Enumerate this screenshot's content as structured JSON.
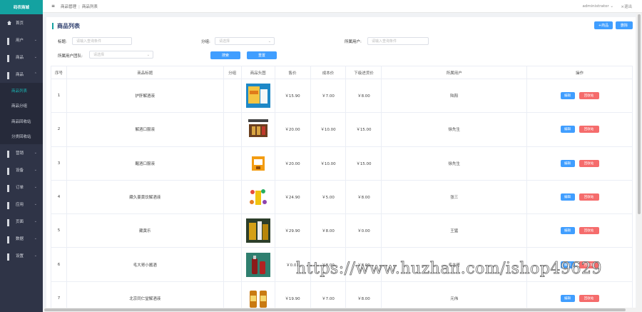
{
  "brand": "码农商城",
  "sidebar": {
    "items": [
      {
        "label": "首页",
        "icon": "home-icon",
        "chevron": false
      },
      {
        "label": "用户",
        "icon": "grid-icon",
        "chevron": true
      },
      {
        "label": "商品",
        "icon": "grid-icon",
        "chevron": true
      },
      {
        "label": "商品",
        "icon": "grid-icon",
        "chevron": true
      }
    ],
    "goods_submenu": [
      "商品列表",
      "商品分组",
      "商品回收站",
      "分类回收站"
    ],
    "items_after": [
      {
        "label": "营销",
        "icon": "grid-icon"
      },
      {
        "label": "设备",
        "icon": "grid-icon"
      },
      {
        "label": "订单",
        "icon": "grid-icon"
      },
      {
        "label": "应用",
        "icon": "grid-icon"
      },
      {
        "label": "页面",
        "icon": "grid-icon"
      },
      {
        "label": "数据",
        "icon": "grid-icon"
      },
      {
        "label": "设置",
        "icon": "grid-icon"
      }
    ]
  },
  "topbar": {
    "breadcrumb": [
      "商品管理",
      "商品列表"
    ],
    "user": "administrator",
    "logout": "退出"
  },
  "page": {
    "title": "商品列表",
    "add_button": "+商品",
    "delete_button": "删除"
  },
  "filters": {
    "title_label": "标题:",
    "title_placeholder": "请输入查询条件",
    "group_label": "分组:",
    "group_placeholder": "请选择",
    "owner_label": "所属用户:",
    "owner_placeholder": "请输入查询条件",
    "owner_group_label": "所属用户团队:",
    "owner_group_placeholder": "请选择",
    "search_button": "搜索",
    "reset_button": "重置"
  },
  "table": {
    "headers": [
      "序号",
      "商品标题",
      "分组",
      "商品头图",
      "售价",
      "成本价",
      "下级进货价",
      "所属用户",
      "操作"
    ],
    "edit_label": "编辑",
    "delete_label": "回收站",
    "rows": [
      {
        "no": "1",
        "title": "护肝解酒液",
        "group": "",
        "price": "￥15.90",
        "cost": "￥7.00",
        "sub_price": "￥8.00",
        "owner": "陆阳"
      },
      {
        "no": "2",
        "title": "解酒口服液",
        "group": "",
        "price": "￥20.00",
        "cost": "￥10.00",
        "sub_price": "￥15.00",
        "owner": "徐先生"
      },
      {
        "no": "3",
        "title": "醒酒口服液",
        "group": "",
        "price": "￥20.00",
        "cost": "￥10.00",
        "sub_price": "￥15.00",
        "owner": "徐先生"
      },
      {
        "no": "4",
        "title": "藏久姜黄饮解酒液",
        "group": "",
        "price": "￥24.90",
        "cost": "￥5.00",
        "sub_price": "￥8.00",
        "owner": "张三"
      },
      {
        "no": "5",
        "title": "藏黄乐",
        "group": "",
        "price": "￥29.90",
        "cost": "￥8.00",
        "sub_price": "￥0.00",
        "owner": "王猛"
      },
      {
        "no": "6",
        "title": "毛大哥小酱酒",
        "group": "",
        "price": "￥0.01",
        "cost": "￥8.00",
        "sub_price": "￥8.00",
        "owner": "毛大哥"
      },
      {
        "no": "7",
        "title": "北京同仁堂解酒液",
        "group": "",
        "price": "￥19.90",
        "cost": "￥7.00",
        "sub_price": "￥8.00",
        "owner": "元伟"
      }
    ]
  },
  "watermark": "https://www.huzhan.com/ishop49629"
}
